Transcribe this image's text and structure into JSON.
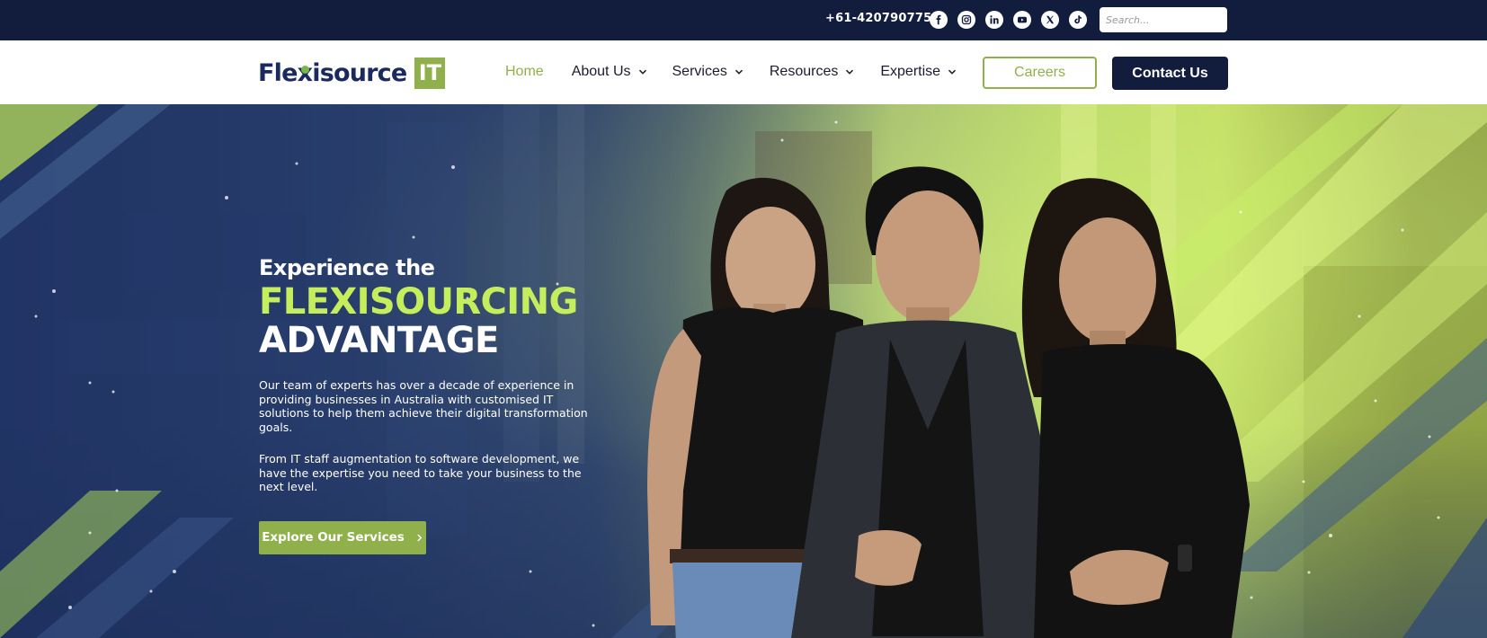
{
  "topbar": {
    "phone": "+61-420790775",
    "socials": [
      "facebook-icon",
      "instagram-icon",
      "linkedin-icon",
      "youtube-icon",
      "x-twitter-icon",
      "tiktok-icon"
    ],
    "search_placeholder": "Search..."
  },
  "logo": {
    "part1": "Fle",
    "part2": "isource",
    "badge": "IT"
  },
  "nav": {
    "items": [
      {
        "label": "Home",
        "dropdown": false,
        "active": true
      },
      {
        "label": "About Us",
        "dropdown": true
      },
      {
        "label": "Services",
        "dropdown": true
      },
      {
        "label": "Resources",
        "dropdown": true
      },
      {
        "label": "Expertise",
        "dropdown": true
      }
    ],
    "careers": "Careers",
    "contact": "Contact Us"
  },
  "hero": {
    "line1": "Experience the",
    "line2": "FLEXISOURCING",
    "line3": "ADVANTAGE",
    "para1": "Our team of experts has over a decade of experience in providing businesses in Australia with customised IT solutions to help them achieve their digital transformation goals.",
    "para2": "From IT staff augmentation to software development, we have the expertise you need to take your business to the next level.",
    "cta": "Explore Our Services"
  },
  "colors": {
    "navy": "#121c3d",
    "accent_green": "#8fb04b",
    "headline_green": "#c5ee5c"
  }
}
